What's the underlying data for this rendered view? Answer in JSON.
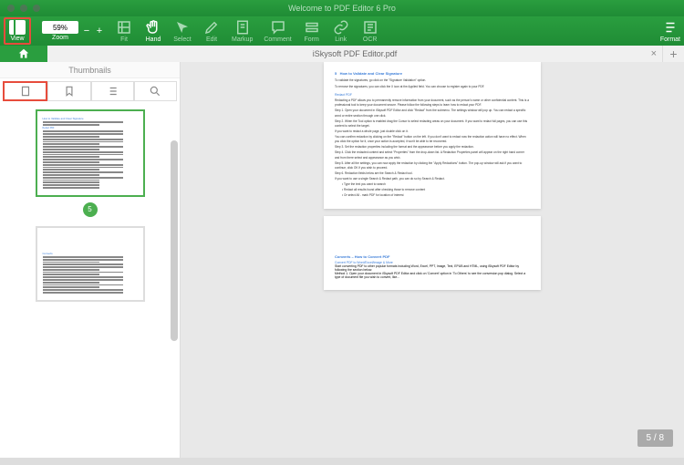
{
  "titlebar": {
    "welcome": "Welcome to PDF Editor 6 Pro"
  },
  "toolbar": {
    "view_label": "View",
    "zoom_value": "59%",
    "zoom_label": "Zoom",
    "minus": "−",
    "plus": "+",
    "items": [
      {
        "label": "Fit"
      },
      {
        "label": "Hand"
      },
      {
        "label": "Select"
      },
      {
        "label": "Edit"
      },
      {
        "label": "Markup"
      },
      {
        "label": "Comment"
      },
      {
        "label": "Form"
      },
      {
        "label": "Link"
      },
      {
        "label": "OCR"
      }
    ],
    "format_label": "Format"
  },
  "tabs": {
    "document_title": "iSkysoft PDF Editor.pdf",
    "close": "×",
    "plus": "+"
  },
  "sidebar": {
    "header": "Thumbnails",
    "badge_5": "5",
    "thumb5_title": "How to Validate and Clear Signature",
    "thumb5_sub": "Redact PDF"
  },
  "page5": {
    "num": "5",
    "h1": "How to Validate and Clear Signature",
    "p1": "To validate the signatures, go click on the \"Signature Validation\" option.",
    "p2": "To remove the signatures, you can click the X icon at the Applied field. You can choose to register again to your PDF.",
    "redact": "Redact PDF",
    "r1": "Redacting a PDF allows you to permanently remove information from your document, such as the person's name or other confidential content. This is a professional tool to keep your document secure. Please follow the following steps to learn how to redact your PDF.",
    "r2": "Step 1. Open your document in iSkysoft PDF Editor and click \"Redact\" from the submenu. The settings window will pop up. You can redact a specific word or entire section through one click.",
    "r3": "Step 2. When the Tool option is enabled drag the Cursor to select redacting areas on your document. If you want to redact full pages, you can use this content to select the target.",
    "r4": "If you want to redact a whole page, just double click on it.",
    "r5": "You can confirm redaction by clicking on the \"Redact\" button on the left. If you don't want to redact now the redaction action will have no effect. When you click the option for it, once your action is accepted, it won't be able to be recovered.",
    "r6": "Step 3. Set the redaction properties including the format and the appearance before you apply the redaction.",
    "r7": "Step 4. Click the redacted content and select \"Properties\" from the drop-down list. A Redaction Properties panel will appear on the right hand corner and from there select and appearance as you wish.",
    "r8": "Step 5. After all the settings, you can now apply the redaction by clicking the \"Apply Redactions\" button. The pop-up window will ask if you want to continue, click OK if you wish to proceed.",
    "r9": "Step 6. Redaction fields below are the Search & Redact tool.",
    "r10": "If you want to use a single Search & Redact path, you can do so by Search & Redact.",
    "b1": "Type the text you want to search",
    "b2": "Redact all results found after checking those to remove content",
    "b3": "Or select All - mark PDF for location of interest"
  },
  "page6": {
    "title": "Converts – How to Convert PDF",
    "sub": "Convert PDF to Word/Excel/Image & More",
    "p1": "Start converting PDF to other popular formats including Word, Excel, PPT, Image, Text, EPUB and HTML, using iSkysoft PDF Editor by following the section below.",
    "p2": "Method 1. Open your document in iSkysoft PDF Editor and click on 'Convert' option in 'To Others' to see the conversion pop dialog. Select a type of document file you wish to convert, like..."
  },
  "page_indicator": {
    "current": "5",
    "sep": " / ",
    "total": "8"
  }
}
